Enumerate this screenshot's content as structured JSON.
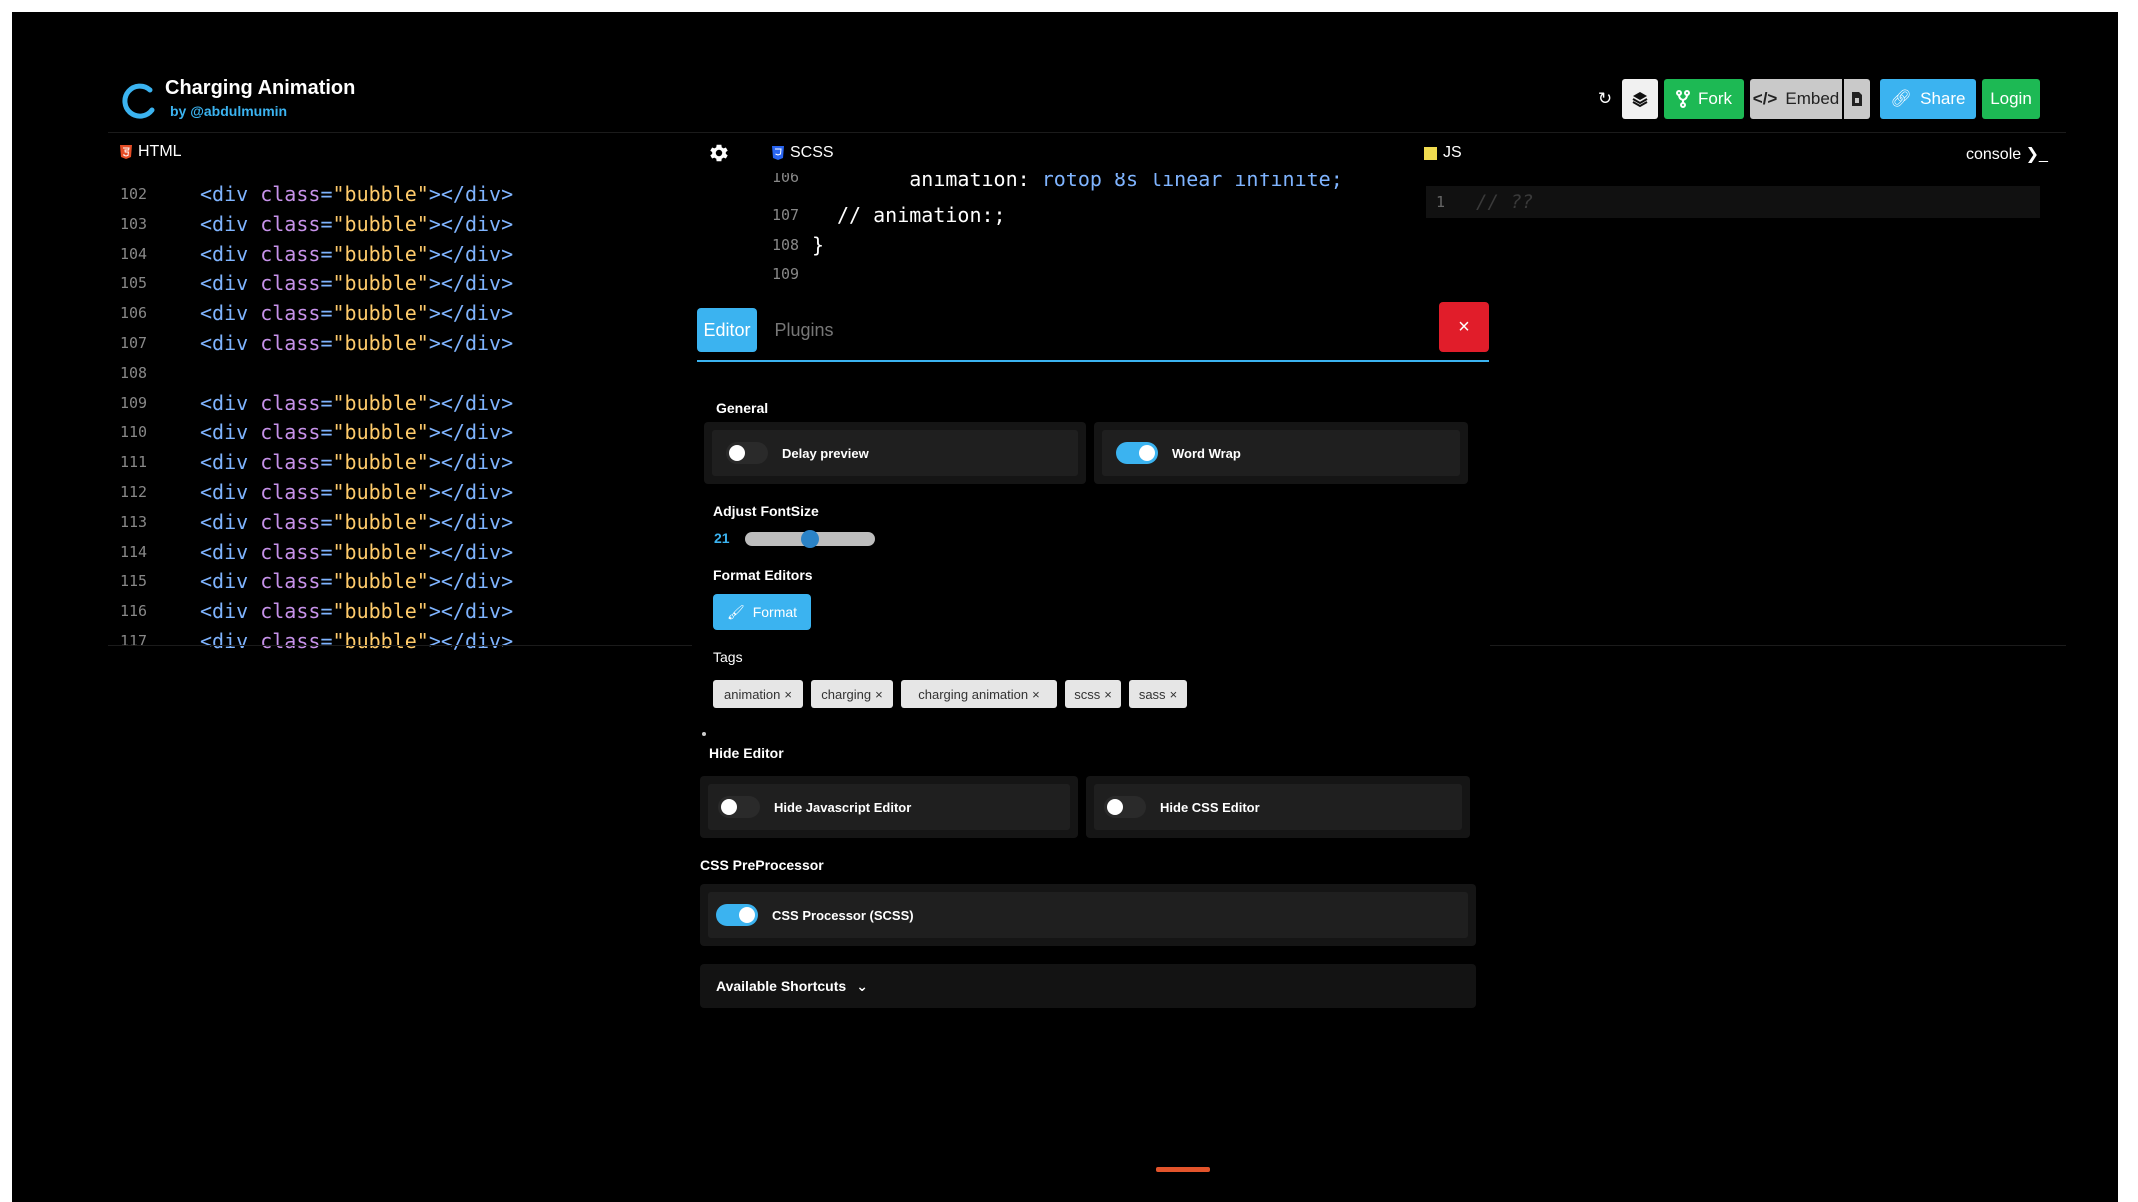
{
  "header": {
    "title": "Charging Animation",
    "author": "by @abdulmumin",
    "buttons": {
      "fork": "Fork",
      "embed": "Embed",
      "share": "Share",
      "login": "Login"
    }
  },
  "panels": {
    "html": "HTML",
    "scss": "SCSS",
    "js": "JS",
    "console": "console"
  },
  "html_code": [
    {
      "ln": "102",
      "empty": false
    },
    {
      "ln": "103",
      "empty": false
    },
    {
      "ln": "104",
      "empty": false
    },
    {
      "ln": "105",
      "empty": false
    },
    {
      "ln": "106",
      "empty": false
    },
    {
      "ln": "107",
      "empty": false
    },
    {
      "ln": "108",
      "empty": true
    },
    {
      "ln": "109",
      "empty": false
    },
    {
      "ln": "110",
      "empty": false
    },
    {
      "ln": "111",
      "empty": false
    },
    {
      "ln": "112",
      "empty": false
    },
    {
      "ln": "113",
      "empty": false
    },
    {
      "ln": "114",
      "empty": false
    },
    {
      "ln": "115",
      "empty": false
    },
    {
      "ln": "116",
      "empty": false
    },
    {
      "ln": "117",
      "empty": false
    }
  ],
  "html_tokens": {
    "open": "<",
    "tag": "div",
    "attr": "class",
    "eq": "=",
    "value": "\"bubble\"",
    "close": "></",
    "end": ">"
  },
  "scss_code": [
    {
      "ln": "106",
      "text_prop": "animation: ",
      "text_val": "rotop 8s linear infinite;",
      "cut": true
    },
    {
      "ln": "107",
      "comment": "// animation:;"
    },
    {
      "ln": "108",
      "brace": "}"
    },
    {
      "ln": "109",
      "empty": true
    }
  ],
  "js_code": [
    {
      "ln": "1",
      "text": "// ??"
    }
  ],
  "settings": {
    "tabs": {
      "editor": "Editor",
      "plugins": "Plugins"
    },
    "close": "×",
    "general": {
      "title": "General",
      "delay_preview": {
        "label": "Delay preview",
        "on": false
      },
      "word_wrap": {
        "label": "Word Wrap",
        "on": true
      }
    },
    "font_size": {
      "title": "Adjust FontSize",
      "value": "21",
      "min": 10,
      "max": 32
    },
    "format": {
      "title": "Format Editors",
      "button": "Format"
    },
    "tags": {
      "title": "Tags",
      "items": [
        "animation",
        "charging",
        "charging animation",
        "scss",
        "sass"
      ]
    },
    "hide_editor": {
      "title": "Hide Editor",
      "js": {
        "label": "Hide Javascript Editor",
        "on": false
      },
      "css": {
        "label": "Hide CSS Editor",
        "on": false
      }
    },
    "css_preprocessor": {
      "title": "CSS PreProcessor",
      "scss": {
        "label": "CSS Processor (SCSS)",
        "on": true
      }
    },
    "shortcuts": "Available Shortcuts"
  },
  "colors": {
    "accent": "#3bb3f0",
    "green": "#1db954",
    "danger": "#e11d2a",
    "background": "#000000"
  }
}
